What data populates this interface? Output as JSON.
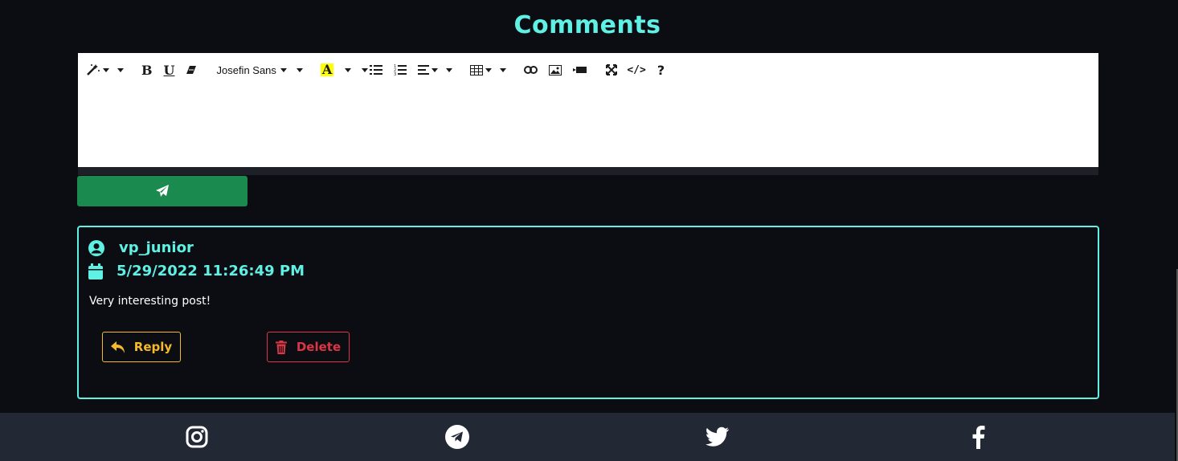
{
  "page": {
    "title": "Comments",
    "colors": {
      "accent": "#5ff1e3",
      "background": "#0b0d12",
      "send": "#1b8a4f",
      "reply": "#f5b92a",
      "delete": "#dc3545",
      "footer": "#222834"
    }
  },
  "editor": {
    "toolbar": {
      "style_icon": "magic-wand-icon",
      "bold_label": "B",
      "underline_label": "U",
      "clear_format_icon": "eraser-icon",
      "font_family_value": "Josefin Sans",
      "color_label": "A",
      "unordered_list_icon": "ul-list-icon",
      "ordered_list_icon": "ol-list-icon",
      "paragraph_icon": "align-left-icon",
      "table_icon": "table-icon",
      "link_icon": "link-icon",
      "picture_icon": "picture-icon",
      "video_icon": "video-icon",
      "fullscreen_icon": "fullscreen-icon",
      "codeview_label": "</>",
      "help_label": "?"
    },
    "content": ""
  },
  "send_button": {
    "icon": "paper-plane-icon"
  },
  "comment": {
    "username": "vp_junior",
    "date": "5/29/2022 11:26:49 PM",
    "text": "Very interesting post!",
    "reply_label": "Reply",
    "delete_label": "Delete"
  },
  "footer": {
    "links": [
      "instagram-icon",
      "telegram-icon",
      "twitter-icon",
      "facebook-icon"
    ]
  }
}
